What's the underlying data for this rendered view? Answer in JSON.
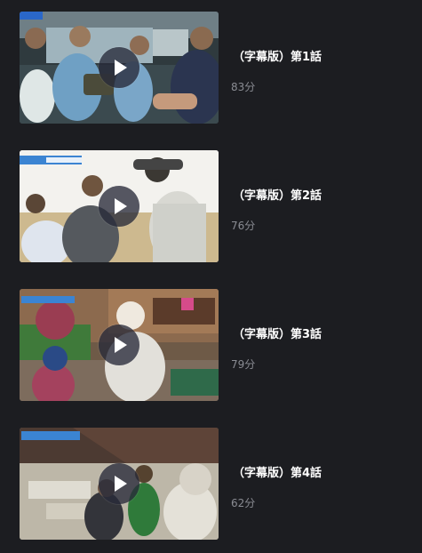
{
  "episodes": [
    {
      "title": "（字幕版）第1話",
      "duration": "83分"
    },
    {
      "title": "（字幕版）第2話",
      "duration": "76分"
    },
    {
      "title": "（字幕版）第3話",
      "duration": "79分"
    },
    {
      "title": "（字幕版）第4話",
      "duration": "62分"
    }
  ],
  "icons": {
    "play": "play-icon"
  },
  "colors": {
    "background": "#1c1d21",
    "title": "#ffffff",
    "duration": "#8a8c93",
    "play_button": "#282a3a"
  }
}
